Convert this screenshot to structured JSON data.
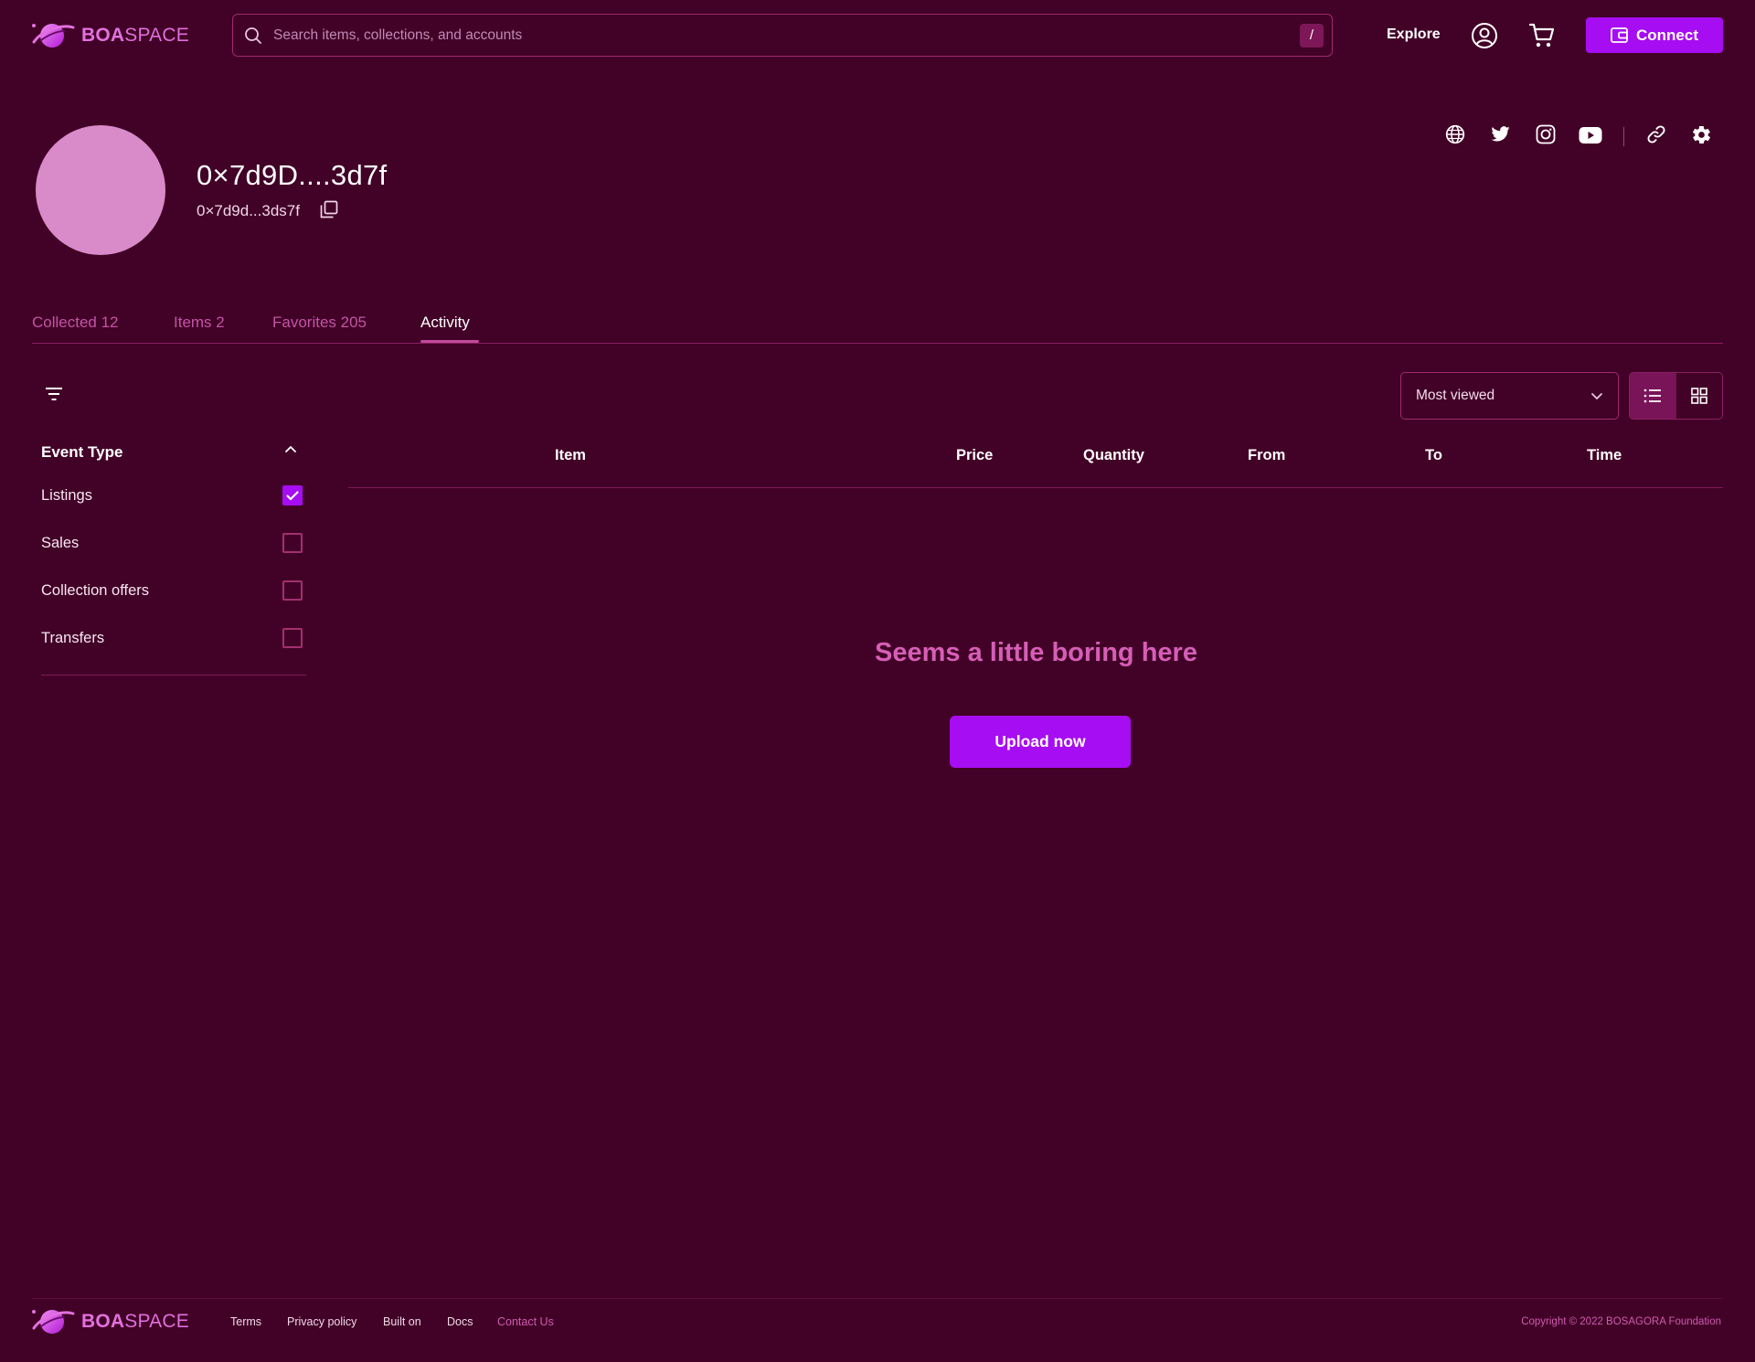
{
  "brand": {
    "bold": "BOA",
    "light": "SPACE"
  },
  "header": {
    "search_placeholder": "Search items, collections, and accounts",
    "search_shortcut": "/",
    "explore_label": "Explore",
    "connect_label": "Connect"
  },
  "profile": {
    "name": "0×7d9D....3d7f",
    "address": "0×7d9d...3ds7f"
  },
  "tabs": [
    {
      "label": "Collected  12",
      "active": false
    },
    {
      "label": "Items 2",
      "active": false
    },
    {
      "label": "Favorites 205",
      "active": false
    },
    {
      "label": "Activity",
      "active": true
    }
  ],
  "sort": {
    "selected": "Most viewed"
  },
  "filters": {
    "title": "Event Type",
    "options": [
      {
        "label": "Listings",
        "checked": true
      },
      {
        "label": "Sales",
        "checked": false
      },
      {
        "label": "Collection offers",
        "checked": false
      },
      {
        "label": "Transfers",
        "checked": false
      }
    ]
  },
  "table": {
    "columns": [
      "Item",
      "Price",
      "Quantity",
      "From",
      "To",
      "Time"
    ]
  },
  "empty_state": {
    "message": "Seems a little boring here",
    "button_label": "Upload now"
  },
  "footer": {
    "links": [
      "Terms",
      "Privacy policy",
      "Built on",
      "Docs",
      "Contact Us"
    ],
    "copyright": "Copyright © 2022 BOSAGORA Foundation"
  },
  "colors": {
    "background": "#420126",
    "accent": "#a60df2",
    "pink": "#d65eb7",
    "border": "#a02b6f"
  }
}
